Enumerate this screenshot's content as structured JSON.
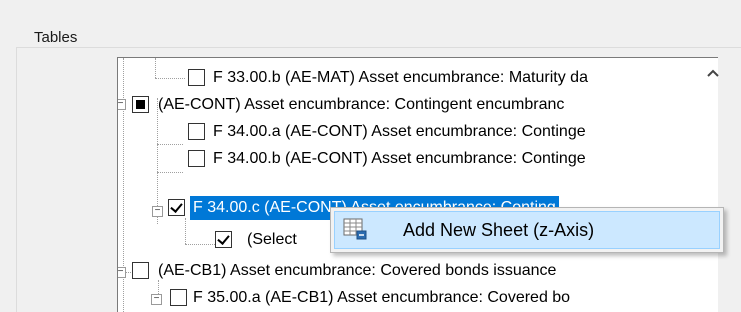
{
  "groupbox": {
    "title": "Tables"
  },
  "tree": {
    "rows": [
      {
        "label": "F 33.00.b (AE-MAT) Asset encumbrance: Maturity da",
        "state": "unchecked"
      },
      {
        "label": "(AE-CONT) Asset encumbrance: Contingent encumbranc",
        "state": "partial",
        "expander": "−"
      },
      {
        "label": "F 34.00.a (AE-CONT) Asset encumbrance: Continge",
        "state": "unchecked"
      },
      {
        "label": "F 34.00.b (AE-CONT) Asset encumbrance: Continge",
        "state": "unchecked"
      },
      {
        "label": "F 34.00.c (AE-CONT) Asset encumbrance: Conting",
        "state": "checked",
        "expander": "−",
        "selected": true
      },
      {
        "label": "(Select",
        "state": "checked"
      },
      {
        "label": "(AE-CB1) Asset encumbrance: Covered bonds issuance",
        "state": "unchecked",
        "expander": "−"
      },
      {
        "label": "F 35.00.a (AE-CB1) Asset encumbrance: Covered bo",
        "state": "unchecked",
        "expander": "−"
      }
    ],
    "scroll_up_icon": "chevron-up-icon"
  },
  "context_menu": {
    "items": [
      {
        "label": "Add New Sheet (z-Axis)",
        "icon": "add-sheet-icon"
      }
    ]
  }
}
